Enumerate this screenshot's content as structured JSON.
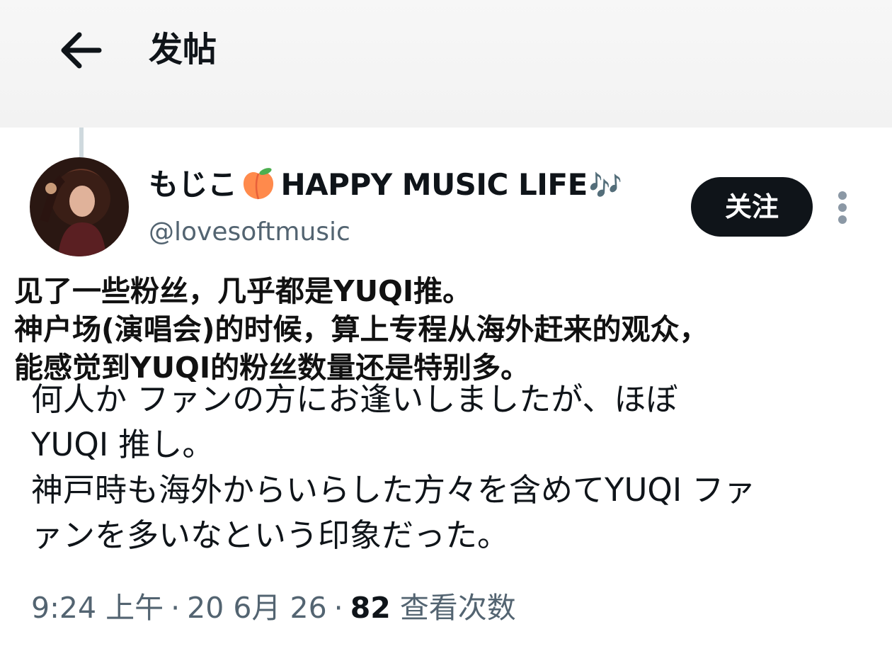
{
  "header": {
    "title": "发帖"
  },
  "author": {
    "display_name": "もじこ",
    "display_name_suffix": "HAPPY MUSIC LIFE",
    "peach_icon": "peach-emoji",
    "notes_glyph": "🎶",
    "handle": "@lovesoftmusic"
  },
  "actions": {
    "follow_label": "关注"
  },
  "overlay_caption": [
    "见了一些粉丝，几乎都是YUQI推。",
    "神户场(演唱会)的时候，算上专程从海外赶来的观众，",
    "能感觉到YUQI的粉丝数量还是特别多。"
  ],
  "tweet_lines": [
    "何人か ファンの方にお逢いしましたが、ほぼ",
    "YUQI 推し。",
    "神戸時も海外からいらした方々を含めてYUQI ファ",
    "ァンを多いなという印象だった。"
  ],
  "meta": {
    "time": "9:24 上午",
    "date": "20 6月 26",
    "views_count": "82",
    "views_label": "查看次数",
    "separator": "·"
  },
  "colors": {
    "button_bg": "#0f1419",
    "secondary_text": "#536471",
    "header_bg": "#f4f4f4"
  }
}
